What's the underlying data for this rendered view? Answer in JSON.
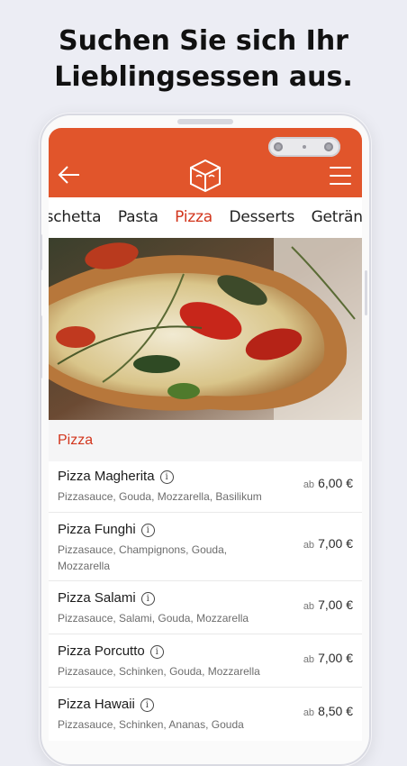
{
  "headline": {
    "line1": "Suchen Sie sich Ihr",
    "line2": "Lieblingsessen aus."
  },
  "appbar": {
    "color": "#e1552b",
    "back_icon": "arrow-left-icon",
    "logo_icon": "box-logo-icon",
    "menu_icon": "hamburger-menu-icon"
  },
  "tabs": {
    "items": [
      {
        "label": "uschetta"
      },
      {
        "label": "Pasta"
      },
      {
        "label": "Pizza"
      },
      {
        "label": "Desserts"
      },
      {
        "label": "Getränke"
      }
    ],
    "active": "Pizza",
    "active_color": "#d2361d"
  },
  "section": {
    "title": "Pizza"
  },
  "menu_items": [
    {
      "name": "Pizza Magherita",
      "desc": "Pizzasauce, Gouda, Mozzarella, Basilikum",
      "price_prefix": "ab",
      "price": "6,00 €"
    },
    {
      "name": "Pizza Funghi",
      "desc": "Pizzasauce, Champignons, Gouda, Mozzarella",
      "price_prefix": "ab",
      "price": "7,00 €"
    },
    {
      "name": "Pizza Salami",
      "desc": "Pizzasauce, Salami, Gouda, Mozzarella",
      "price_prefix": "ab",
      "price": "7,00 €"
    },
    {
      "name": "Pizza Porcutto",
      "desc": "Pizzasauce, Schinken, Gouda, Mozzarella",
      "price_prefix": "ab",
      "price": "7,00 €"
    },
    {
      "name": "Pizza Hawaii",
      "desc": "Pizzasauce, Schinken, Ananas, Gouda",
      "price_prefix": "ab",
      "price": "8,50 €"
    }
  ]
}
